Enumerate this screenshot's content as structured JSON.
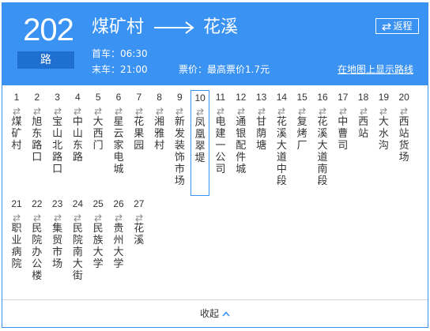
{
  "header": {
    "route_number": "202",
    "route_unit": "路",
    "from": "煤矿村",
    "to": "花溪",
    "first_bus": "首车：06:30",
    "last_bus": "末车：21:00",
    "fare": "票价：最高票价1.7元",
    "map_link": "在地图上显示路线",
    "return_label": "返程",
    "colors": {
      "header_bg": "#3a92f3",
      "unit_bg": "#1f6fd1",
      "accent": "#3d8ff0"
    }
  },
  "stops": [
    {
      "num": "1",
      "name": "煤矿村"
    },
    {
      "num": "2",
      "name": "旭东路口"
    },
    {
      "num": "3",
      "name": "宝山北路口"
    },
    {
      "num": "4",
      "name": "中山东路"
    },
    {
      "num": "5",
      "name": "大西门"
    },
    {
      "num": "6",
      "name": "星云家电城"
    },
    {
      "num": "7",
      "name": "花果园"
    },
    {
      "num": "8",
      "name": "湘雅村"
    },
    {
      "num": "9",
      "name": "新发装饰市场"
    },
    {
      "num": "10",
      "name": "凤凰翠堤"
    },
    {
      "num": "11",
      "name": "电建一公司"
    },
    {
      "num": "12",
      "name": "通银配件城"
    },
    {
      "num": "13",
      "name": "甘荫塘"
    },
    {
      "num": "14",
      "name": "花溪大道中段"
    },
    {
      "num": "15",
      "name": "复烤厂"
    },
    {
      "num": "16",
      "name": "花溪大道南段"
    },
    {
      "num": "17",
      "name": "中曹司"
    },
    {
      "num": "18",
      "name": "西站"
    },
    {
      "num": "19",
      "name": "大水沟"
    },
    {
      "num": "20",
      "name": "西站货场"
    },
    {
      "num": "21",
      "name": "职业病院"
    },
    {
      "num": "22",
      "name": "民院办公楼"
    },
    {
      "num": "23",
      "name": "集贸市场"
    },
    {
      "num": "24",
      "name": "民院南大街"
    },
    {
      "num": "25",
      "name": "民族大学"
    },
    {
      "num": "26",
      "name": "贵州大学"
    },
    {
      "num": "27",
      "name": "花溪"
    }
  ],
  "active_stop": "10",
  "footer": {
    "collapse_label": "收起"
  }
}
